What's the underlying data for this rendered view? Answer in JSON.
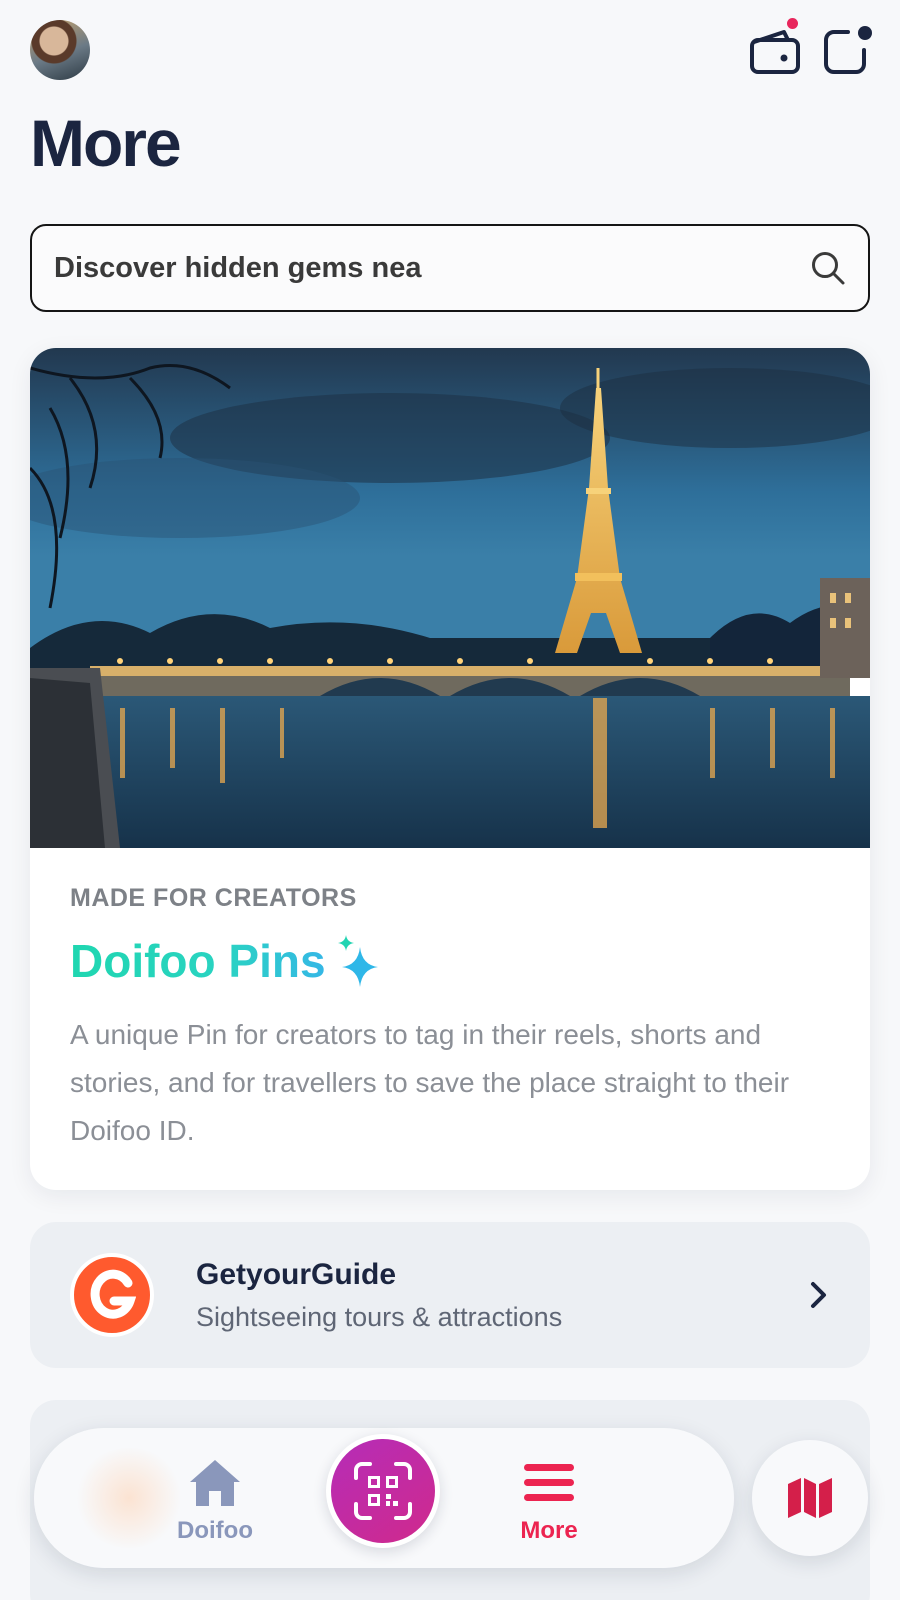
{
  "header": {
    "title": "More",
    "avatar_icon": "user-avatar",
    "wallet_icon": "wallet-icon",
    "notifications_icon": "notifications-icon",
    "wallet_dot_color": "#e8265c",
    "notifications_dot_color": "#1b2540"
  },
  "search": {
    "text": "Discover hidden gems nea",
    "icon": "search-icon"
  },
  "promo": {
    "image": "Eiffel Tower at night over the Seine",
    "eyebrow": "MADE FOR CREATORS",
    "title": "Doifoo Pins",
    "sparkle_icon": "sparkle-icon",
    "description": "A unique Pin for creators to tag in their reels, shorts and stories, and for travellers to save the place straight to their Doifoo ID."
  },
  "partners": [
    {
      "name": "GetyourGuide",
      "subtitle": "Sightseeing tours & attractions",
      "logo_color": "#ff5a2e",
      "chevron_icon": "chevron-right-icon"
    }
  ],
  "tabbar": {
    "home_label": "Doifoo",
    "home_icon": "home-icon",
    "scan_icon": "qr-scan-icon",
    "more_label": "More",
    "more_icon": "menu-icon",
    "map_icon": "map-icon",
    "active_color": "#ec2450",
    "inactive_color": "#8a97bb",
    "scan_gradient": [
      "#b52cb8",
      "#d02a8c"
    ]
  }
}
